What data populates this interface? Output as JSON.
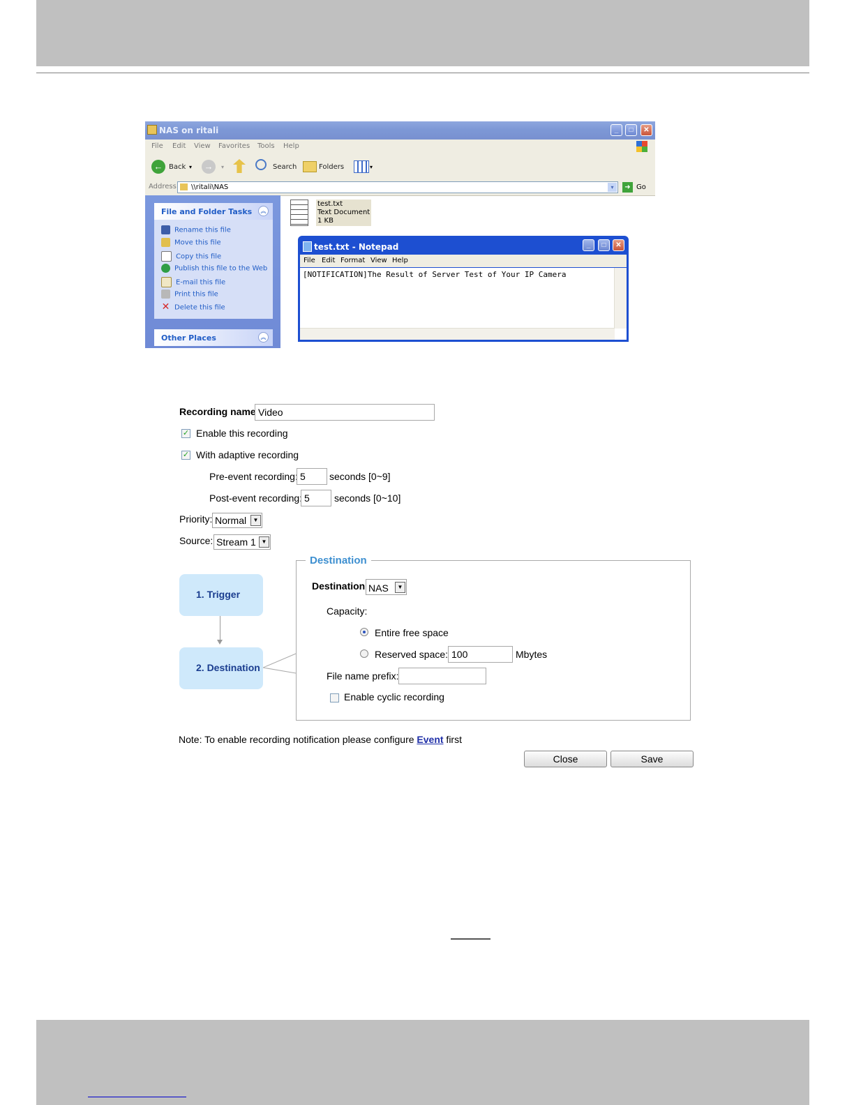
{
  "explorer": {
    "title": "NAS on ritali",
    "menu": [
      "File",
      "Edit",
      "View",
      "Favorites",
      "Tools",
      "Help"
    ],
    "toolbar": {
      "back": "Back",
      "search": "Search",
      "folders": "Folders"
    },
    "address_label": "Address",
    "address_value": "\\\\ritali\\NAS",
    "go": "Go",
    "tasks_panel": {
      "title": "File and Folder Tasks",
      "items": [
        "Rename this file",
        "Move this file",
        "Copy this file",
        "Publish this file to the Web",
        "E-mail this file",
        "Print this file",
        "Delete this file"
      ]
    },
    "other_places_title": "Other Places",
    "file": {
      "name": "test.txt",
      "type": "Text Document",
      "size": "1 KB"
    }
  },
  "notepad": {
    "title": "test.txt - Notepad",
    "menu": [
      "File",
      "Edit",
      "Format",
      "View",
      "Help"
    ],
    "content": "[NOTIFICATION]The Result of Server Test of Your IP Camera"
  },
  "recording": {
    "name_label": "Recording name:",
    "name_value": "Video",
    "enable_label": "Enable this recording",
    "enable_checked": true,
    "adaptive_label": "With adaptive recording",
    "adaptive_checked": true,
    "pre_event_label": "Pre-event recording:",
    "pre_event_value": "5",
    "pre_event_unit": "seconds [0~9]",
    "post_event_label": "Post-event recording:",
    "post_event_value": "5",
    "post_event_unit": "seconds [0~10]",
    "priority_label": "Priority:",
    "priority_value": "Normal",
    "source_label": "Source:",
    "source_value": "Stream 1",
    "steps": [
      "1.  Trigger",
      "2.  Destination"
    ],
    "destination_legend": "Destination",
    "destination_label": "Destination:",
    "destination_value": "NAS",
    "capacity_label": "Capacity:",
    "entire_free_label": "Entire free space",
    "reserved_label": "Reserved space:",
    "reserved_value": "100",
    "reserved_unit": "Mbytes",
    "prefix_label": "File name prefix:",
    "prefix_value": "",
    "cyclic_label": "Enable cyclic recording",
    "cyclic_checked": false,
    "note_prefix": "Note: To enable recording notification please configure ",
    "note_link": "Event",
    "note_suffix": " first",
    "close_button": "Close",
    "save_button": "Save"
  }
}
